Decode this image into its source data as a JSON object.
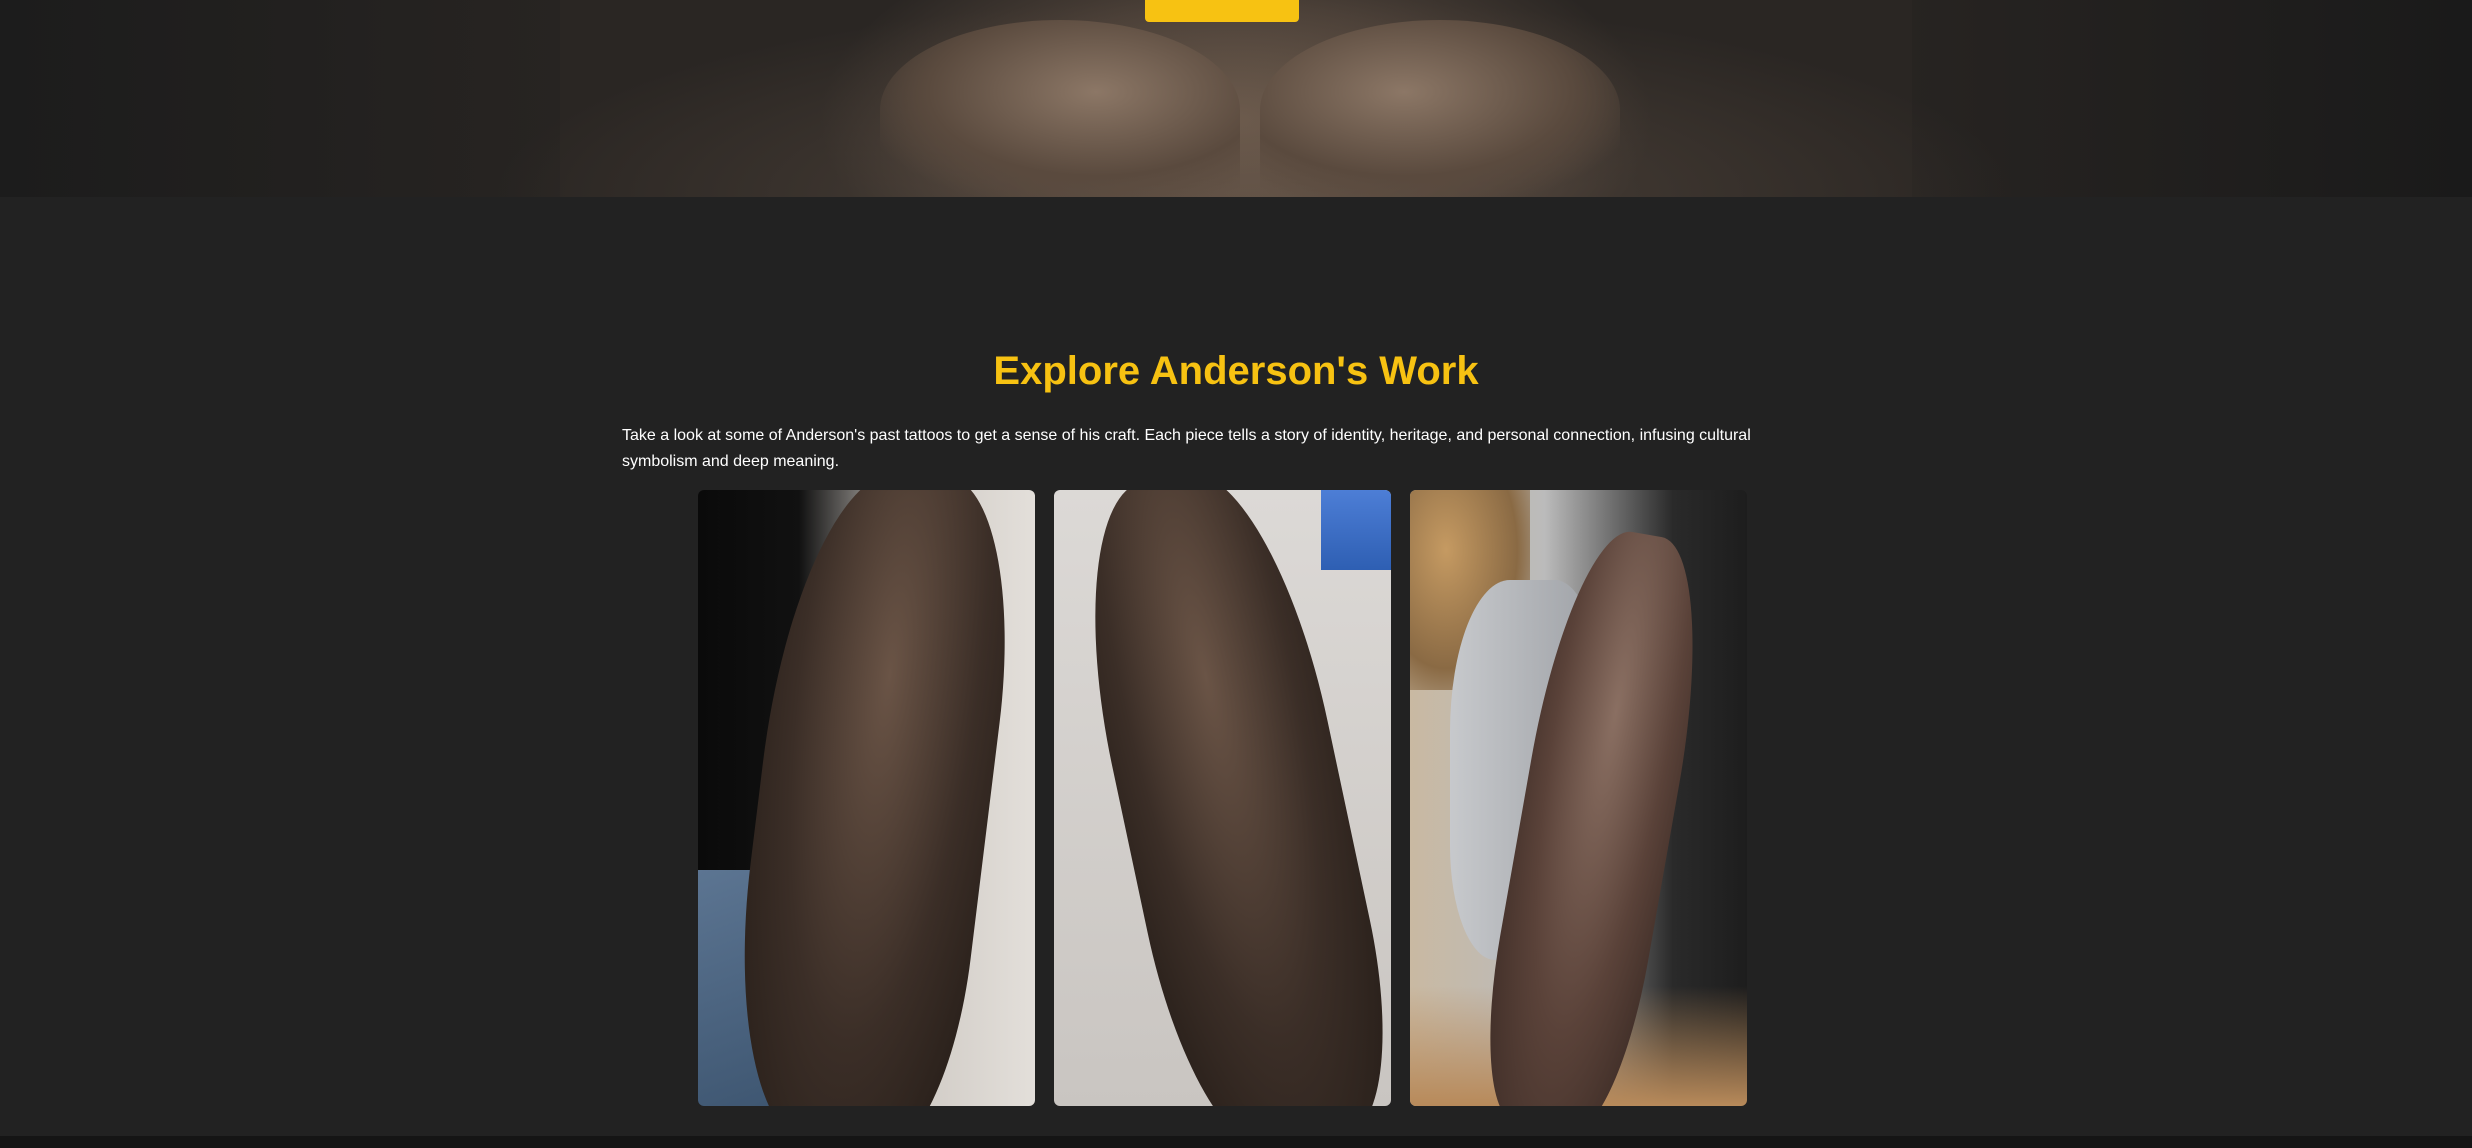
{
  "hero": {
    "button_label": ""
  },
  "work": {
    "title": "Explore Anderson's Work",
    "description": "Take a look at some of Anderson's past tattoos to get a sense of his craft. Each piece tells a story of identity, heritage, and personal connection, infusing cultural symbolism and deep meaning."
  },
  "colors": {
    "accent": "#f7c212",
    "background": "#222222"
  }
}
